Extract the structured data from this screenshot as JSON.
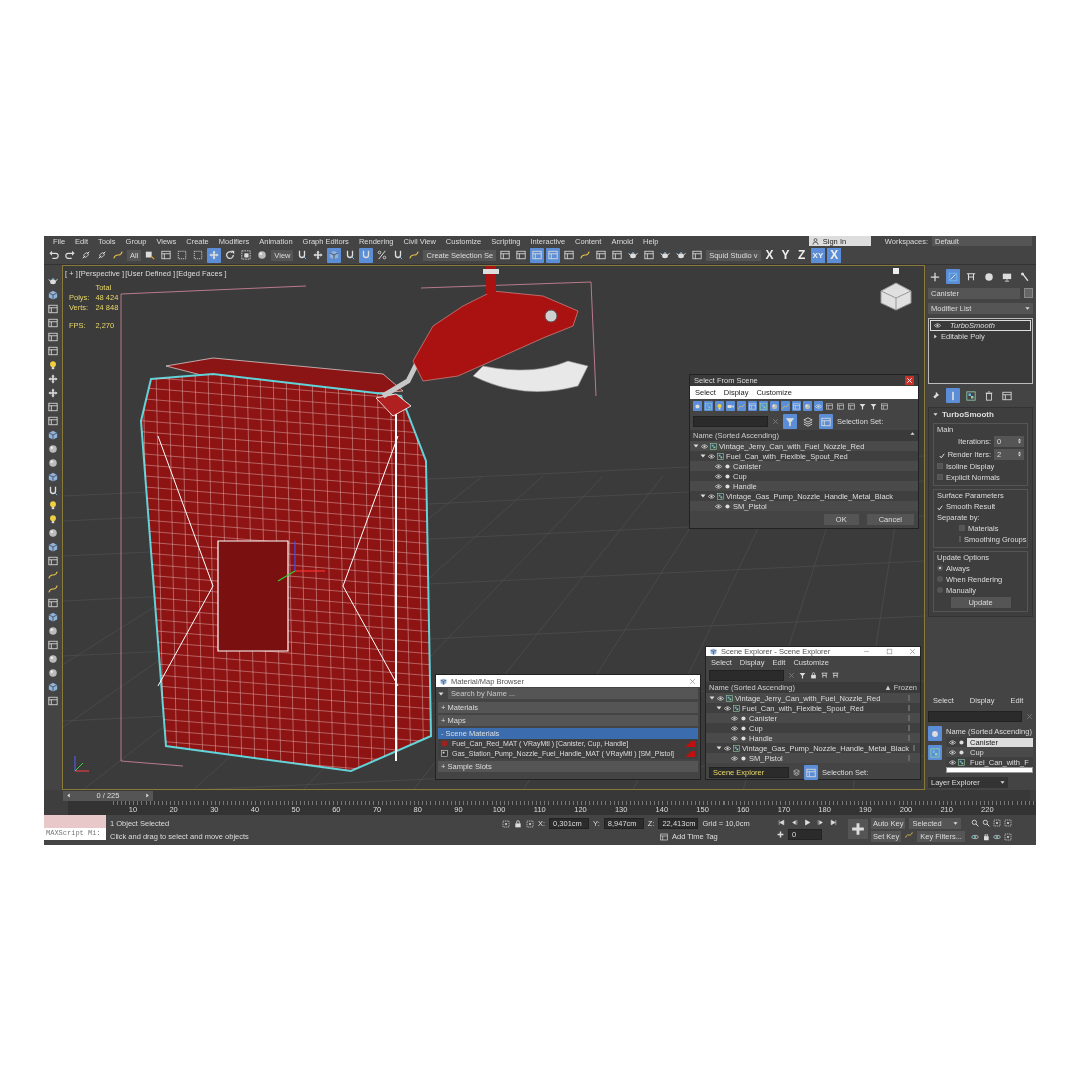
{
  "menu": [
    "File",
    "Edit",
    "Tools",
    "Group",
    "Views",
    "Create",
    "Modifiers",
    "Animation",
    "Graph Editors",
    "Rendering",
    "Civil View",
    "Customize",
    "Scripting",
    "Interactive",
    "Content",
    "Arnold",
    "Help"
  ],
  "account": {
    "label": "Sign In"
  },
  "workspaces": {
    "label": "Workspaces:",
    "value": "Default"
  },
  "toolbar": [
    {
      "kind": "undo",
      "selected": false
    },
    {
      "kind": "redo",
      "selected": false
    },
    {
      "kind": "link",
      "selected": false
    },
    {
      "kind": "link",
      "selected": false
    },
    {
      "kind": "curve",
      "selected": false
    },
    {
      "kind": "dropdown",
      "value": "All"
    },
    {
      "kind": "select",
      "selected": false
    },
    {
      "kind": "panel",
      "selected": false
    },
    {
      "kind": "region",
      "selected": false
    },
    {
      "kind": "region",
      "selected": false
    },
    {
      "kind": "move",
      "selected": true
    },
    {
      "kind": "rotate",
      "selected": false
    },
    {
      "kind": "scale",
      "selected": false
    },
    {
      "kind": "sphere",
      "selected": false
    },
    {
      "kind": "dropdown",
      "value": "View"
    },
    {
      "kind": "magnet",
      "selected": false
    },
    {
      "kind": "move",
      "selected": false
    },
    {
      "kind": "box",
      "selected": true
    },
    {
      "kind": "magnet",
      "selected": false
    },
    {
      "kind": "magnet",
      "selected": true
    },
    {
      "kind": "percent",
      "selected": false
    },
    {
      "kind": "magnet",
      "selected": false
    },
    {
      "kind": "curve",
      "selected": false
    },
    {
      "kind": "dropdown",
      "value": "Create Selection Se"
    },
    {
      "kind": "panel",
      "selected": false
    },
    {
      "kind": "panel",
      "selected": false
    },
    {
      "kind": "panel",
      "selected": true
    },
    {
      "kind": "panel",
      "selected": true
    },
    {
      "kind": "panel",
      "selected": false
    },
    {
      "kind": "curve",
      "selected": false
    },
    {
      "kind": "panel",
      "selected": false
    },
    {
      "kind": "panel",
      "selected": false
    },
    {
      "kind": "teapot",
      "selected": false
    },
    {
      "kind": "panel",
      "selected": false
    },
    {
      "kind": "teapot",
      "selected": false
    },
    {
      "kind": "teapot",
      "selected": false
    },
    {
      "kind": "panel",
      "selected": false
    },
    {
      "kind": "dropdown",
      "value": "Squid Studio v"
    },
    {
      "kind": "axis",
      "value": "X",
      "selected": false
    },
    {
      "kind": "axis",
      "value": "Y",
      "selected": false
    },
    {
      "kind": "axis",
      "value": "Z",
      "selected": false
    },
    {
      "kind": "axis",
      "value": "XY",
      "selected": true
    },
    {
      "kind": "axis",
      "value": "X",
      "selected": true
    }
  ],
  "left_toolbar": [
    {
      "kind": "teapot"
    },
    {
      "kind": "box"
    },
    {
      "kind": "panel"
    },
    {
      "kind": "panel"
    },
    {
      "kind": "panel"
    },
    {
      "kind": "panel"
    },
    {
      "kind": "light"
    },
    {
      "kind": "move"
    },
    {
      "kind": "move"
    },
    {
      "kind": "panel"
    },
    {
      "kind": "panel"
    },
    {
      "kind": "box"
    },
    {
      "kind": "sphere"
    },
    {
      "kind": "sphere"
    },
    {
      "kind": "box"
    },
    {
      "kind": "magnet"
    },
    {
      "kind": "light"
    },
    {
      "kind": "light"
    },
    {
      "kind": "sphere"
    },
    {
      "kind": "box"
    },
    {
      "kind": "panel"
    },
    {
      "kind": "curve"
    },
    {
      "kind": "curve"
    },
    {
      "kind": "panel"
    },
    {
      "kind": "box"
    },
    {
      "kind": "sphere"
    },
    {
      "kind": "panel"
    },
    {
      "kind": "sphere"
    },
    {
      "kind": "sphere"
    },
    {
      "kind": "box"
    },
    {
      "kind": "panel"
    }
  ],
  "viewport": {
    "labels": [
      "[ + ]",
      "[Perspective ]",
      "[User Defined ]",
      "[Edged Faces ]"
    ],
    "stats": {
      "title": "Total",
      "rows": [
        {
          "label": "Polys:",
          "value": "48 424"
        },
        {
          "label": "Verts:",
          "value": "24 848"
        }
      ]
    },
    "fps": {
      "label": "FPS:",
      "value": "2,270"
    }
  },
  "select_from_scene": {
    "title": "Select From Scene",
    "menu": [
      "Select",
      "Display",
      "Customize"
    ],
    "filters": [
      {
        "kind": "dot",
        "selected": true
      },
      {
        "kind": "group",
        "selected": true
      },
      {
        "kind": "light",
        "selected": true
      },
      {
        "kind": "camera",
        "selected": true
      },
      {
        "kind": "curve",
        "selected": true
      },
      {
        "kind": "panel",
        "selected": true
      },
      {
        "kind": "group",
        "selected": true
      },
      {
        "kind": "sphere",
        "selected": true
      },
      {
        "kind": "curve",
        "selected": true
      },
      {
        "kind": "panel",
        "selected": true
      },
      {
        "kind": "sphere",
        "selected": true
      },
      {
        "kind": "eye",
        "selected": true
      },
      {
        "kind": "panel",
        "selected": false
      },
      {
        "kind": "panel",
        "selected": false
      },
      {
        "kind": "panel",
        "selected": false
      },
      {
        "kind": "filter",
        "selected": false
      },
      {
        "kind": "filter",
        "selected": false
      },
      {
        "kind": "panel",
        "selected": false
      }
    ],
    "selection_set_label": "Selection Set:",
    "column": "Name (Sorted Ascending)",
    "tree": [
      {
        "name": "Vintage_Jerry_Can_with_Fuel_Nozzle_Red",
        "kind": "group",
        "expanded": true,
        "children": [
          {
            "name": "Fuel_Can_with_Flexible_Spout_Red",
            "kind": "group",
            "expanded": true,
            "children": [
              {
                "name": "Canister",
                "kind": "object"
              },
              {
                "name": "Cup",
                "kind": "object"
              },
              {
                "name": "Handle",
                "kind": "object"
              }
            ]
          },
          {
            "name": "Vintage_Gas_Pump_Nozzle_Handle_Metal_Black",
            "kind": "group",
            "expanded": true,
            "children": [
              {
                "name": "SM_Pistol",
                "kind": "object"
              }
            ]
          }
        ]
      }
    ],
    "buttons": [
      "OK",
      "Cancel"
    ]
  },
  "material_browser": {
    "title": "Material/Map Browser",
    "search": {
      "placeholder": "Search by Name ..."
    },
    "sections": [
      {
        "label": "+ Materials",
        "expanded": false
      },
      {
        "label": "+ Maps",
        "expanded": false
      },
      {
        "label": "- Scene Materials",
        "expanded": true,
        "items": [
          {
            "name": "Fuel_Can_Red_MAT ( VRayMtl ) [Canister, Cup, Handle]",
            "kind": "sphere"
          },
          {
            "name": "Gas_Station_Pump_Nozzle_Fuel_Handle_MAT ( VRayMtl ) [SM_Pistol]",
            "kind": "map"
          }
        ]
      },
      {
        "label": "+ Sample Slots",
        "expanded": false
      }
    ]
  },
  "scene_explorer": {
    "title": "Scene Explorer - Scene Explorer",
    "menu": [
      "Select",
      "Display",
      "Edit",
      "Customize"
    ],
    "columns": [
      "Name (Sorted Ascending)",
      "▲ Frozen"
    ],
    "tree": [
      {
        "name": "Vintage_Jerry_Can_with_Fuel_Nozzle_Red",
        "kind": "group",
        "expanded": true,
        "children": [
          {
            "name": "Fuel_Can_with_Flexible_Spout_Red",
            "kind": "group",
            "expanded": true,
            "children": [
              {
                "name": "Canister",
                "kind": "object"
              },
              {
                "name": "Cup",
                "kind": "object"
              },
              {
                "name": "Handle",
                "kind": "object"
              }
            ]
          },
          {
            "name": "Vintage_Gas_Pump_Nozzle_Handle_Metal_Black",
            "kind": "group",
            "expanded": true,
            "children": [
              {
                "name": "SM_Pistol",
                "kind": "object"
              }
            ]
          }
        ]
      }
    ],
    "footer": {
      "dropdown": "Scene Explorer",
      "label": "Selection Set:"
    }
  },
  "command_panel": {
    "tabs": [
      {
        "kind": "plus",
        "selected": false
      },
      {
        "kind": "modify",
        "selected": true
      },
      {
        "kind": "hierarchy",
        "selected": false
      },
      {
        "kind": "motion",
        "selected": false
      },
      {
        "kind": "display",
        "selected": false
      },
      {
        "kind": "wrench",
        "selected": false
      }
    ],
    "object_name": "Canister",
    "modifier_list": "Modifier List",
    "stack": [
      {
        "name": "TurboSmooth",
        "kind": "modifier",
        "selected": true
      },
      {
        "name": "Editable Poly",
        "kind": "base",
        "selected": false
      }
    ],
    "stack_tools": [
      {
        "kind": "pin",
        "selected": false
      },
      {
        "kind": "bar",
        "selected": true
      },
      {
        "kind": "group",
        "selected": false
      },
      {
        "kind": "trash",
        "selected": false
      },
      {
        "kind": "panel",
        "selected": false
      }
    ],
    "rollout": {
      "title": "TurboSmooth",
      "groups": [
        {
          "title": "Main",
          "controls": [
            {
              "kind": "spinner",
              "label": "Iterations:",
              "value": "0"
            },
            {
              "kind": "spinner",
              "label": "Render Iters:",
              "value": "2",
              "checked": true
            },
            {
              "kind": "checkbox",
              "label": "Isoline Display",
              "checked": false
            },
            {
              "kind": "checkbox",
              "label": "Explicit Normals",
              "checked": false
            }
          ]
        },
        {
          "title": "Surface Parameters",
          "controls": [
            {
              "kind": "checkbox",
              "label": "Smooth Result",
              "checked": true
            },
            {
              "kind": "text",
              "label": "Separate by:",
              "children": [
                {
                  "kind": "checkbox",
                  "label": "Materials",
                  "checked": false
                },
                {
                  "kind": "checkbox",
                  "label": "Smoothing Groups",
                  "checked": false
                }
              ]
            }
          ]
        },
        {
          "title": "Update Options",
          "controls": [
            {
              "kind": "radio",
              "label": "Always",
              "selected": true
            },
            {
              "kind": "radio",
              "label": "When Rendering",
              "selected": false
            },
            {
              "kind": "radio",
              "label": "Manually",
              "selected": false
            },
            {
              "kind": "button",
              "label": "Update"
            }
          ]
        }
      ]
    }
  },
  "layer_explorer": {
    "menu": [
      "Select",
      "Display",
      "Edit"
    ],
    "column": "Name (Sorted Ascending)",
    "rows": [
      {
        "name": "Canister",
        "kind": "object",
        "selected": true
      },
      {
        "name": "Cup",
        "kind": "object",
        "selected": false
      },
      {
        "name": "Fuel_Can_with_F",
        "kind": "group",
        "selected": false
      }
    ],
    "footer": "Layer Explorer"
  },
  "timeline": {
    "frame": "0 / 225",
    "level": 0,
    "ticks": [
      "10",
      "20",
      "30",
      "40",
      "50",
      "60",
      "70",
      "80",
      "90",
      "100",
      "110",
      "120",
      "130",
      "140",
      "150",
      "160",
      "170",
      "180",
      "190",
      "200",
      "210",
      "220"
    ]
  },
  "status": {
    "maxscript": "MAXScript Mi:",
    "message": "1 Object Selected",
    "prompt": "Click and drag to select and move objects",
    "coords": [
      {
        "label": "X:",
        "value": "0,301cm"
      },
      {
        "label": "Y:",
        "value": "8,947cm"
      },
      {
        "label": "Z:",
        "value": "22,413cm"
      }
    ],
    "grid": "Grid = 10,0cm",
    "time_tag": "Add Time Tag",
    "frame": "0",
    "auto_key": "Auto Key",
    "set_key": "Set Key",
    "key_mode": "Selected",
    "key_filters": "Key Filters..."
  }
}
